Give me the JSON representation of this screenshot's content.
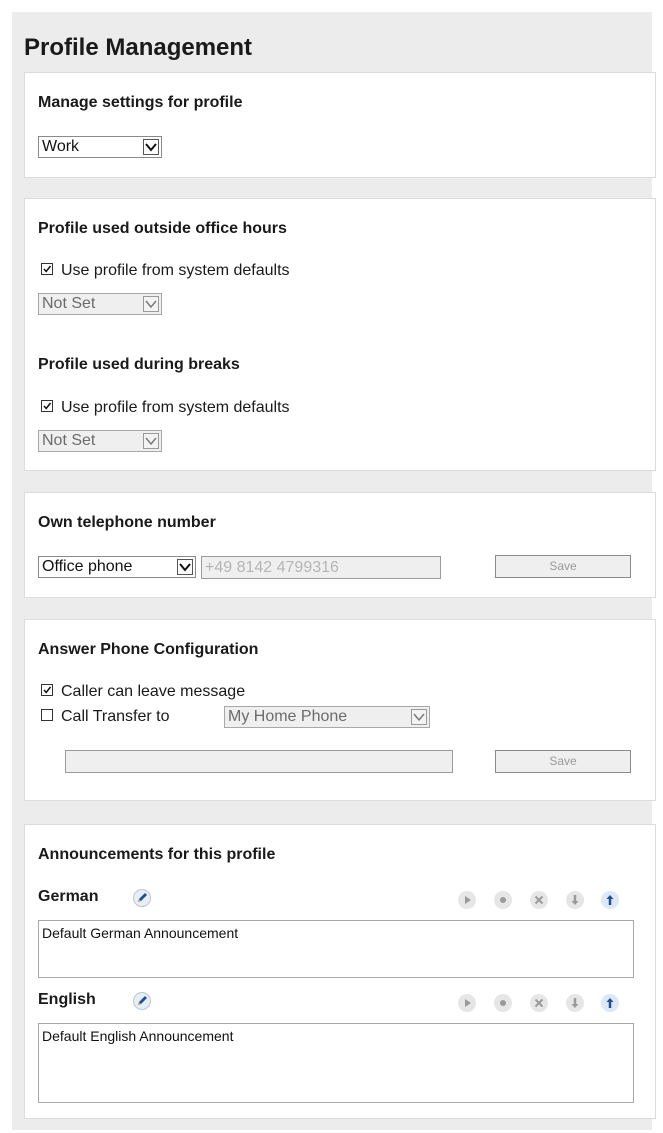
{
  "page": {
    "title": "Profile Management"
  },
  "manage": {
    "title": "Manage settings for profile",
    "profile_select": "Work"
  },
  "outside_hours": {
    "title": "Profile used outside office hours",
    "checkbox_label": "Use profile from system defaults",
    "checked": true,
    "select": "Not Set"
  },
  "breaks": {
    "title": "Profile used during breaks",
    "checkbox_label": "Use profile from system defaults",
    "checked": true,
    "select": "Not Set"
  },
  "own_number": {
    "title": "Own telephone number",
    "phone_type_select": "Office phone",
    "number_value": "+49 8142 4799316",
    "save_label": "Save"
  },
  "answer_phone": {
    "title": "Answer Phone Configuration",
    "caller_leave_message_label": "Caller can leave message",
    "caller_leave_message_checked": true,
    "call_transfer_label": "Call Transfer to",
    "call_transfer_checked": false,
    "call_transfer_select": "My Home Phone",
    "transfer_number_value": "",
    "save_label": "Save"
  },
  "announcements": {
    "title": "Announcements for this profile",
    "items": [
      {
        "language": "German",
        "text": "Default German Announcement"
      },
      {
        "language": "English",
        "text": "Default English Announcement"
      }
    ],
    "controls": [
      "play-icon",
      "record-icon",
      "delete-icon",
      "download-icon",
      "upload-icon"
    ]
  },
  "colors": {
    "panel_bg": "#ffffff",
    "outer_bg": "#ececec",
    "disabled_text": "#b5b5b5",
    "upload_accent": "#1f4f95"
  }
}
